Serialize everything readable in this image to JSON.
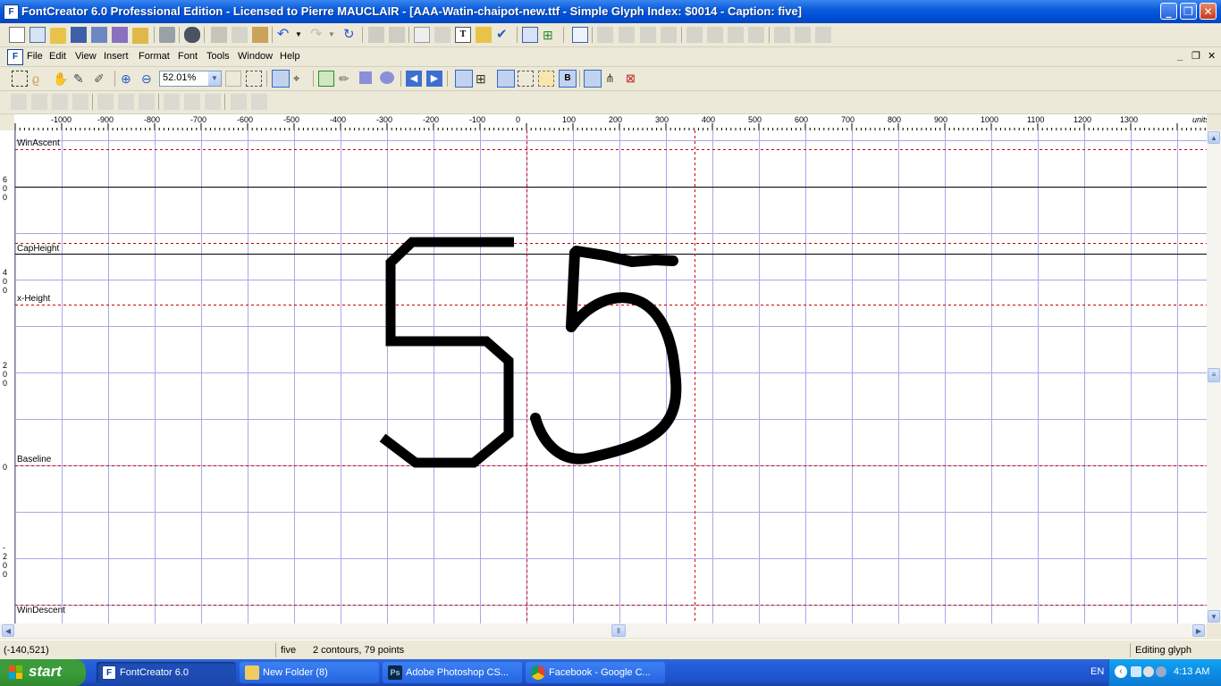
{
  "window": {
    "title": "FontCreator 6.0 Professional Edition - Licensed to Pierre MAUCLAIR - [AAA-Watin-chaipot-new.ttf - Simple Glyph Index: $0014 - Caption: five]",
    "app_icon_letter": "F",
    "minimize": "_",
    "maximize": "❐",
    "close": "✕"
  },
  "menu": {
    "items": [
      "File",
      "Edit",
      "View",
      "Insert",
      "Format",
      "Font",
      "Tools",
      "Window",
      "Help"
    ],
    "mdi_minimize": "_",
    "mdi_restore": "❐",
    "mdi_close": "✕"
  },
  "toolbar2": {
    "zoom_value": "52.01%"
  },
  "ruler": {
    "h_labels": [
      "-1000",
      "-900",
      "-800",
      "-700",
      "-600",
      "-500",
      "-400",
      "-300",
      "-200",
      "-100",
      "0",
      "100",
      "200",
      "300",
      "400",
      "500",
      "600",
      "700",
      "800",
      "900",
      "1000",
      "1100",
      "1200",
      "1300"
    ],
    "units_label": "units",
    "v_labels": [
      {
        "text": [
          "6",
          "0",
          "0"
        ]
      },
      {
        "text": [
          "4",
          "0",
          "0"
        ]
      },
      {
        "text": [
          "2",
          "0",
          "0"
        ]
      },
      {
        "text": [
          "0"
        ]
      },
      {
        "text": [
          "-",
          "2",
          "0",
          "0"
        ]
      }
    ]
  },
  "editor": {
    "guidelines": [
      "WinAscent",
      "CapHeight",
      "x-Height",
      "Baseline",
      "WinDescent"
    ]
  },
  "status": {
    "coords": "(-140,521)",
    "glyph_name": "five",
    "contours": "2 contours, 79 points",
    "mode": "Editing glyph"
  },
  "taskbar": {
    "start": "start",
    "tasks": [
      "FontCreator 6.0",
      "New Folder (8)",
      "Adobe Photoshop CS...",
      "Facebook - Google C..."
    ],
    "lang": "EN",
    "clock": "4:13 AM"
  },
  "colors": {
    "title_blue": "#0A5CDA",
    "grid_blue": "#A8A8E8",
    "guide_red": "#D00000",
    "glyph": "#000000"
  }
}
